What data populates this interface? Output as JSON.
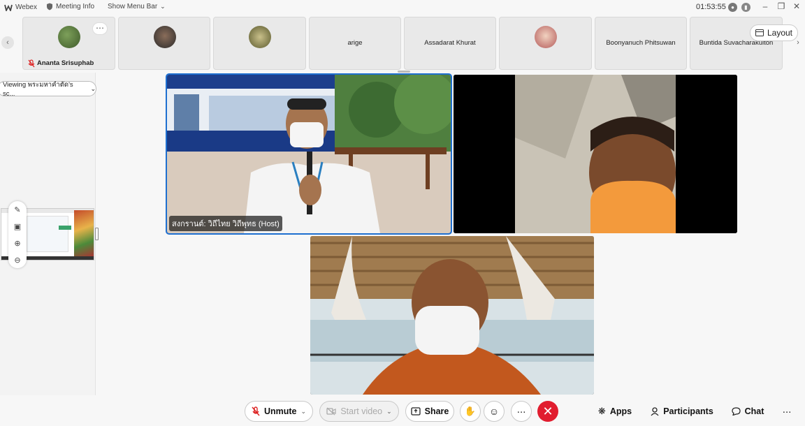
{
  "titlebar": {
    "app_name": "Webex",
    "meeting_info": "Meeting Info",
    "menu_bar": "Show Menu Bar",
    "timer": "01:53:55"
  },
  "participants": [
    {
      "name": "Ananta Srisuphab",
      "has_avatar": true,
      "muted": true
    },
    {
      "name": "",
      "has_avatar": true
    },
    {
      "name": "",
      "has_avatar": true
    },
    {
      "name": "arige",
      "has_avatar": false
    },
    {
      "name": "Assadarat Khurat",
      "has_avatar": false
    },
    {
      "name": "",
      "has_avatar": true
    },
    {
      "name": "Boonyanuch Phitsuwan",
      "has_avatar": false
    },
    {
      "name": "Buntida Suvacharakulton",
      "has_avatar": false
    }
  ],
  "layout_label": "Layout",
  "viewing_label": "Viewing พระมหาคำตัด's sc...",
  "videos": {
    "host_label": "สงกรานต์: วิถีไทย วิถีพุทธ (Host)"
  },
  "controls": {
    "unmute": "Unmute",
    "start_video": "Start video",
    "share": "Share",
    "apps": "Apps",
    "participants": "Participants",
    "chat": "Chat"
  },
  "colors": {
    "end_call": "#e11d2f",
    "active_speaker_border": "#1e6fd0"
  }
}
